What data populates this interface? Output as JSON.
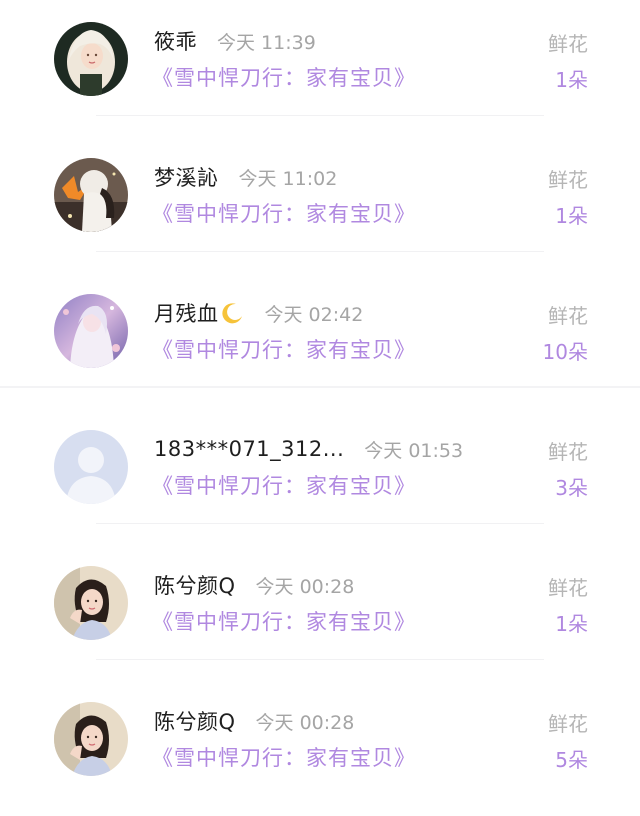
{
  "records": [
    {
      "name": "筱乖",
      "time": "今天 11:39",
      "book": "《雪中悍刀行：家有宝贝》",
      "gift": "鲜花",
      "count": "1朵",
      "avatar_icon": "avatar-white-hair-girl-icon"
    },
    {
      "name": "梦溪訫",
      "time": "今天 11:02",
      "book": "《雪中悍刀行：家有宝贝》",
      "gift": "鲜花",
      "count": "1朵",
      "avatar_icon": "avatar-illustration-girl-icon"
    },
    {
      "name": "月残血",
      "time": "今天 02:42",
      "book": "《雪中悍刀行：家有宝贝》",
      "gift": "鲜花",
      "count": "10朵",
      "avatar_icon": "avatar-anime-girl-icon",
      "badge_icon": "crescent-moon-icon"
    },
    {
      "name": "183***071_312...",
      "time": "今天 01:53",
      "book": "《雪中悍刀行：家有宝贝》",
      "gift": "鲜花",
      "count": "3朵",
      "avatar_icon": "default-avatar-icon"
    },
    {
      "name": "陈兮颜Q",
      "time": "今天 00:28",
      "book": "《雪中悍刀行：家有宝贝》",
      "gift": "鲜花",
      "count": "1朵",
      "avatar_icon": "avatar-photo-girl-icon"
    },
    {
      "name": "陈兮颜Q",
      "time": "今天 00:28",
      "book": "《雪中悍刀行：家有宝贝》",
      "gift": "鲜花",
      "count": "5朵",
      "avatar_icon": "avatar-photo-girl-icon"
    }
  ],
  "colors": {
    "accent": "#b088e0",
    "name_text": "#1f1f1f",
    "muted_text": "#a5a5a5"
  }
}
